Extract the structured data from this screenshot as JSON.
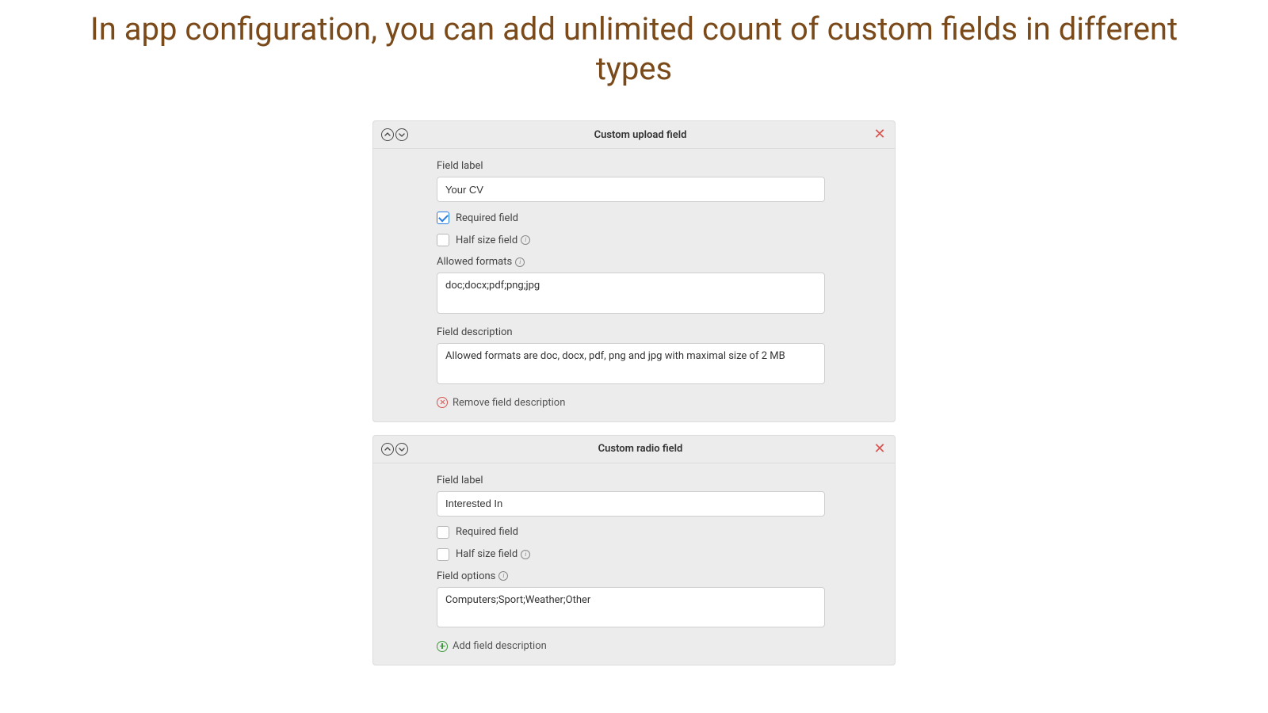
{
  "page": {
    "title": "In app configuration, you can add unlimited count of custom fields in different types"
  },
  "labels": {
    "field_label": "Field label",
    "required_field": "Required field",
    "half_size_field": "Half size field",
    "allowed_formats": "Allowed formats",
    "field_description": "Field description",
    "field_options": "Field options",
    "remove_field_description": "Remove field description",
    "add_field_description": "Add field description"
  },
  "panels": [
    {
      "title": "Custom upload field",
      "field_label_value": "Your CV",
      "required_checked": true,
      "half_size_checked": false,
      "allowed_formats_value": "doc;docx;pdf;png;jpg",
      "field_description_value": "Allowed formats are doc, docx, pdf, png and jpg with maximal size of 2 MB",
      "has_description": true
    },
    {
      "title": "Custom radio field",
      "field_label_value": "Interested In",
      "required_checked": false,
      "half_size_checked": false,
      "field_options_value": "Computers;Sport;Weather;Other",
      "has_description": false
    }
  ]
}
